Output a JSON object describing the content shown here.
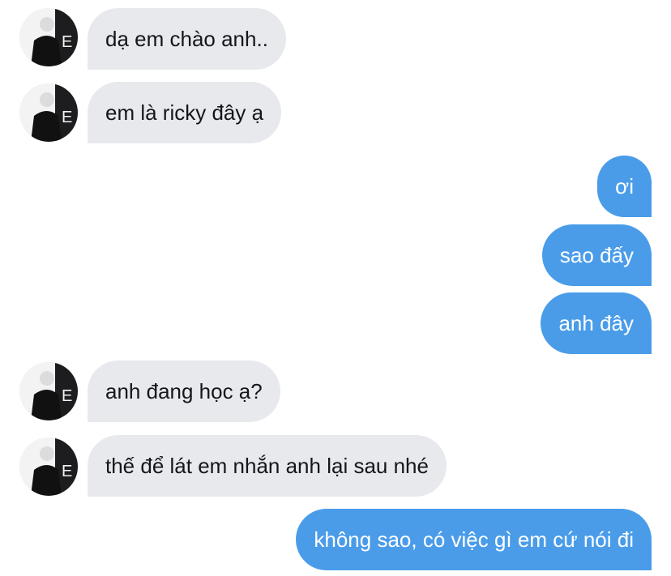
{
  "conversation": {
    "messages": [
      {
        "direction": "incoming",
        "text": "dạ em chào anh.."
      },
      {
        "direction": "incoming",
        "text": "em là ricky đây ạ"
      },
      {
        "direction": "outgoing",
        "text": "ơi"
      },
      {
        "direction": "outgoing",
        "text": "sao đấy"
      },
      {
        "direction": "outgoing",
        "text": "anh đây"
      },
      {
        "direction": "incoming",
        "text": "anh đang học ạ?"
      },
      {
        "direction": "incoming",
        "text": "thế để lát em nhắn anh lại sau nhé"
      },
      {
        "direction": "outgoing",
        "text": "không sao, có việc gì em cứ nói đi"
      }
    ]
  },
  "colors": {
    "incoming_bubble": "#e7e9ed",
    "incoming_text": "#14171a",
    "outgoing_bubble": "#4a9ce9",
    "outgoing_text": "#ffffff"
  }
}
